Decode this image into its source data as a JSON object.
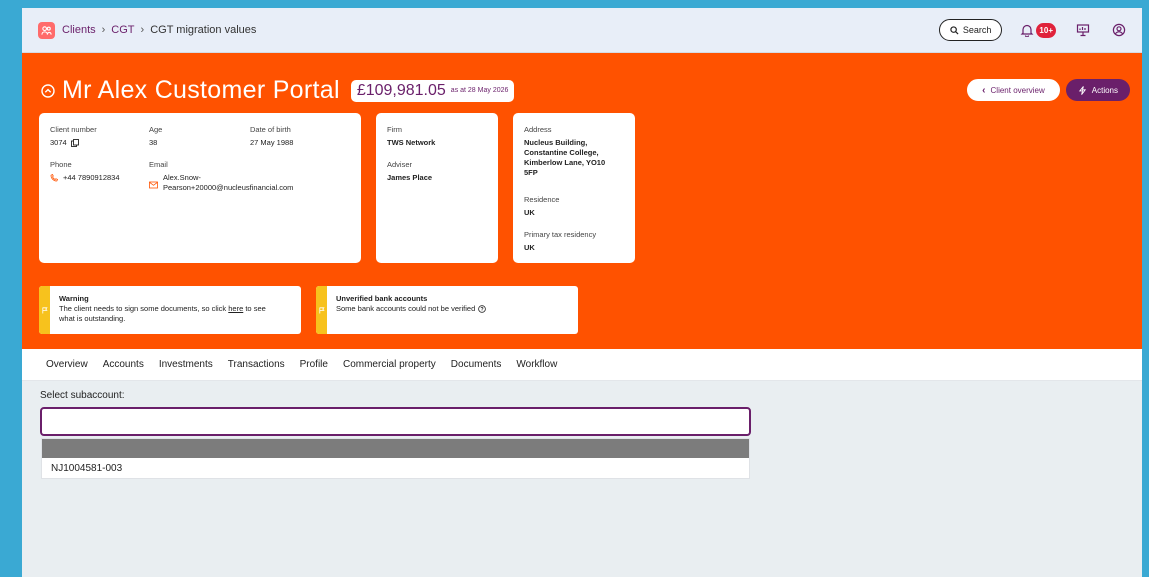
{
  "breadcrumb": {
    "items": [
      "Clients",
      "CGT",
      "CGT migration values"
    ]
  },
  "topbar": {
    "search_label": "Search",
    "notification_count": "10+"
  },
  "client": {
    "name": "Mr Alex Customer Portal",
    "value": "£109,981.05",
    "value_date": "as at 28 May 2026"
  },
  "hero_actions": {
    "overview_label": "Client overview",
    "actions_label": "Actions"
  },
  "details": {
    "client_number_label": "Client number",
    "client_number": "3074",
    "age_label": "Age",
    "age": "38",
    "dob_label": "Date of birth",
    "dob": "27 May 1988",
    "phone_label": "Phone",
    "phone": "+44 7890912834",
    "email_label": "Email",
    "email_line1": "Alex.Snow-",
    "email_line2": "Pearson+20000@nucleusfinancial.com"
  },
  "firm": {
    "firm_label": "Firm",
    "firm": "TWS Network",
    "adviser_label": "Adviser",
    "adviser": "James Place"
  },
  "address": {
    "address_label": "Address",
    "line1": "Nucleus Building,",
    "line2": "Constantine College,",
    "line3": "Kimberlow Lane, YO10",
    "line4": "5FP",
    "residence_label": "Residence",
    "residence": "UK",
    "tax_label": "Primary tax residency",
    "tax": "UK"
  },
  "alerts": {
    "warning": {
      "title": "Warning",
      "text_before": "The client needs to sign some documents, so click ",
      "link": "here",
      "text_after": " to see",
      "text_line2": "what is outstanding."
    },
    "bank": {
      "title": "Unverified bank accounts",
      "text": "Some bank accounts could not be verified"
    }
  },
  "tabs": [
    "Overview",
    "Accounts",
    "Investments",
    "Transactions",
    "Profile",
    "Commercial property",
    "Documents",
    "Workflow"
  ],
  "subaccount": {
    "label": "Select subaccount:",
    "input_value": "",
    "options": [
      "NJ1004581-003"
    ]
  },
  "colors": {
    "brand_orange": "#ff5200",
    "brand_purple": "#6a1f6a",
    "warning_yellow": "#f7c21d",
    "badge_red": "#e0223b"
  }
}
